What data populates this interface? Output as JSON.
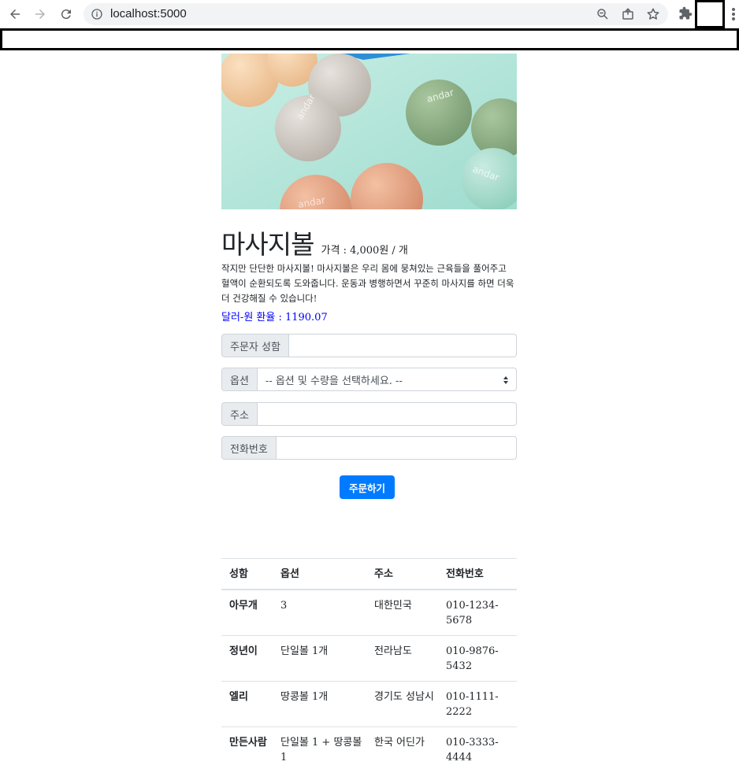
{
  "browser": {
    "url": "localhost:5000"
  },
  "product": {
    "image_description": "andar",
    "title": "마사지볼",
    "price_label": "가격 : 4,000원 / 개",
    "description": "작지만 단단한 마사지볼! 마사지볼은 우리 몸에 뭉쳐있는 근육들을 풀어주고 혈액이 순환되도록 도와줍니다. 운동과 병행하면서 꾸준히 마사지를 하면 더욱 더 건강해질 수 있습니다!",
    "exchange_rate": "달러-원 환율 : 1190.07"
  },
  "form": {
    "name_label": "주문자 성함",
    "name_value": "",
    "option_label": "옵션",
    "option_selected": "-- 옵션 및 수량을 선택하세요. --",
    "address_label": "주소",
    "address_value": "",
    "phone_label": "전화번호",
    "phone_value": "",
    "submit_label": "주문하기"
  },
  "orders": {
    "headers": [
      "성함",
      "옵션",
      "주소",
      "전화번호"
    ],
    "rows": [
      [
        "아무개",
        "3",
        "대한민국",
        "010-1234-5678"
      ],
      [
        "정년이",
        "단일볼 1개",
        "전라남도",
        "010-9876-5432"
      ],
      [
        "엘리",
        "땅콩볼 1개",
        "경기도 성남시",
        "010-1111-2222"
      ],
      [
        "만든사람",
        "단일볼 1 + 땅콩볼 1",
        "한국 어딘가",
        "010-3333-4444"
      ]
    ]
  },
  "colors": {
    "primary_button": "#007bff",
    "exchange_rate_text": "#0000ff"
  }
}
